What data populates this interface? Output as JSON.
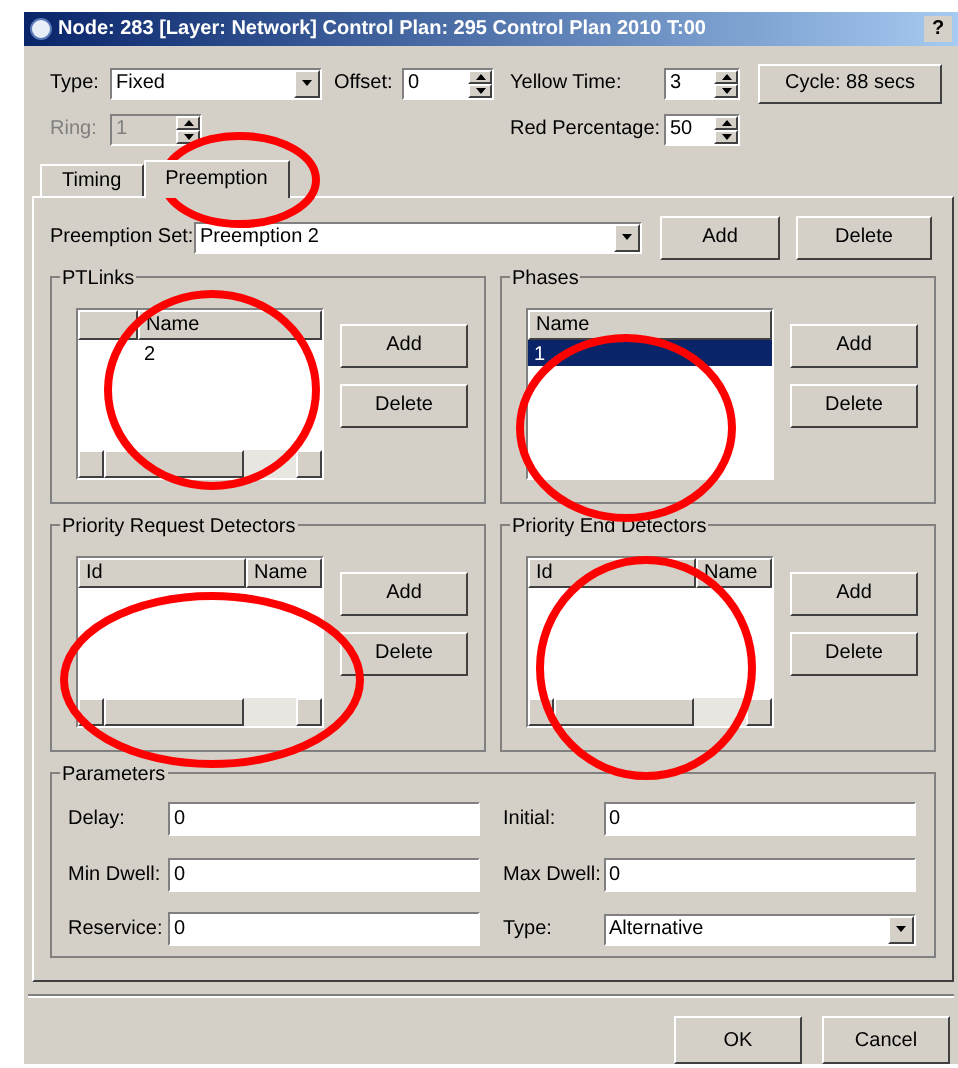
{
  "window": {
    "title": "Node: 283 [Layer: Network] Control Plan: 295 Control Plan 2010 T:00",
    "help": "?"
  },
  "type": {
    "label": "Type:",
    "value": "Fixed"
  },
  "offset": {
    "label": "Offset:",
    "value": "0"
  },
  "yellow_time": {
    "label": "Yellow Time:",
    "value": "3"
  },
  "cycle_button": "Cycle: 88 secs",
  "ring": {
    "label": "Ring:",
    "value": "1",
    "disabled": true
  },
  "red_percentage": {
    "label": "Red Percentage:",
    "value": "50"
  },
  "tabs": [
    {
      "label": "Timing",
      "selected": false
    },
    {
      "label": "Preemption",
      "selected": true
    }
  ],
  "preemption_set": {
    "label": "Preemption Set:",
    "value": "Preemption 2",
    "buttons": [
      "Add",
      "Delete"
    ]
  },
  "groups": [
    {
      "title": "PTLinks",
      "columns": [
        "",
        "Name"
      ],
      "rows": [
        {
          "cells": [
            "",
            "2"
          ],
          "selected": false
        }
      ],
      "horizontal_scrollbar": true,
      "buttons": [
        "Add",
        "Delete"
      ]
    },
    {
      "title": "Phases",
      "columns": [
        "Name"
      ],
      "rows": [
        {
          "cells": [
            "1"
          ],
          "selected": true
        }
      ],
      "horizontal_scrollbar": false,
      "buttons": [
        "Add",
        "Delete"
      ]
    },
    {
      "title": "Priority Request Detectors",
      "columns": [
        "Id",
        "Name"
      ],
      "horizontal_scrollbar": true,
      "buttons": [
        "Add",
        "Delete"
      ]
    },
    {
      "title": "Priority End Detectors",
      "columns": [
        "Id",
        "Name"
      ],
      "horizontal_scrollbar": true,
      "buttons": [
        "Add",
        "Delete"
      ]
    }
  ],
  "parameters": {
    "title": "Parameters",
    "fields": [
      {
        "label": "Delay:",
        "value": "0",
        "kind": "text"
      },
      {
        "label": "Initial:",
        "value": "0",
        "kind": "text"
      },
      {
        "label": "Min Dwell:",
        "value": "0",
        "kind": "text"
      },
      {
        "label": "Max Dwell:",
        "value": "0",
        "kind": "text"
      },
      {
        "label": "Reservice:",
        "value": "0",
        "kind": "text"
      },
      {
        "label": "Type:",
        "value": "Alternative",
        "kind": "dropdown"
      }
    ]
  },
  "buttons": [
    "OK",
    "Cancel"
  ]
}
